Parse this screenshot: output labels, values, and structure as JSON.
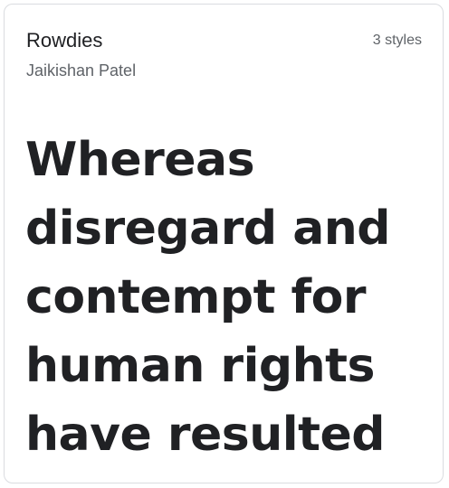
{
  "card": {
    "font_name": "Rowdies",
    "styles_count": "3 styles",
    "designer": "Jaikishan Patel",
    "sample_text": "Whereas disregard and contempt for human rights have resulted"
  }
}
